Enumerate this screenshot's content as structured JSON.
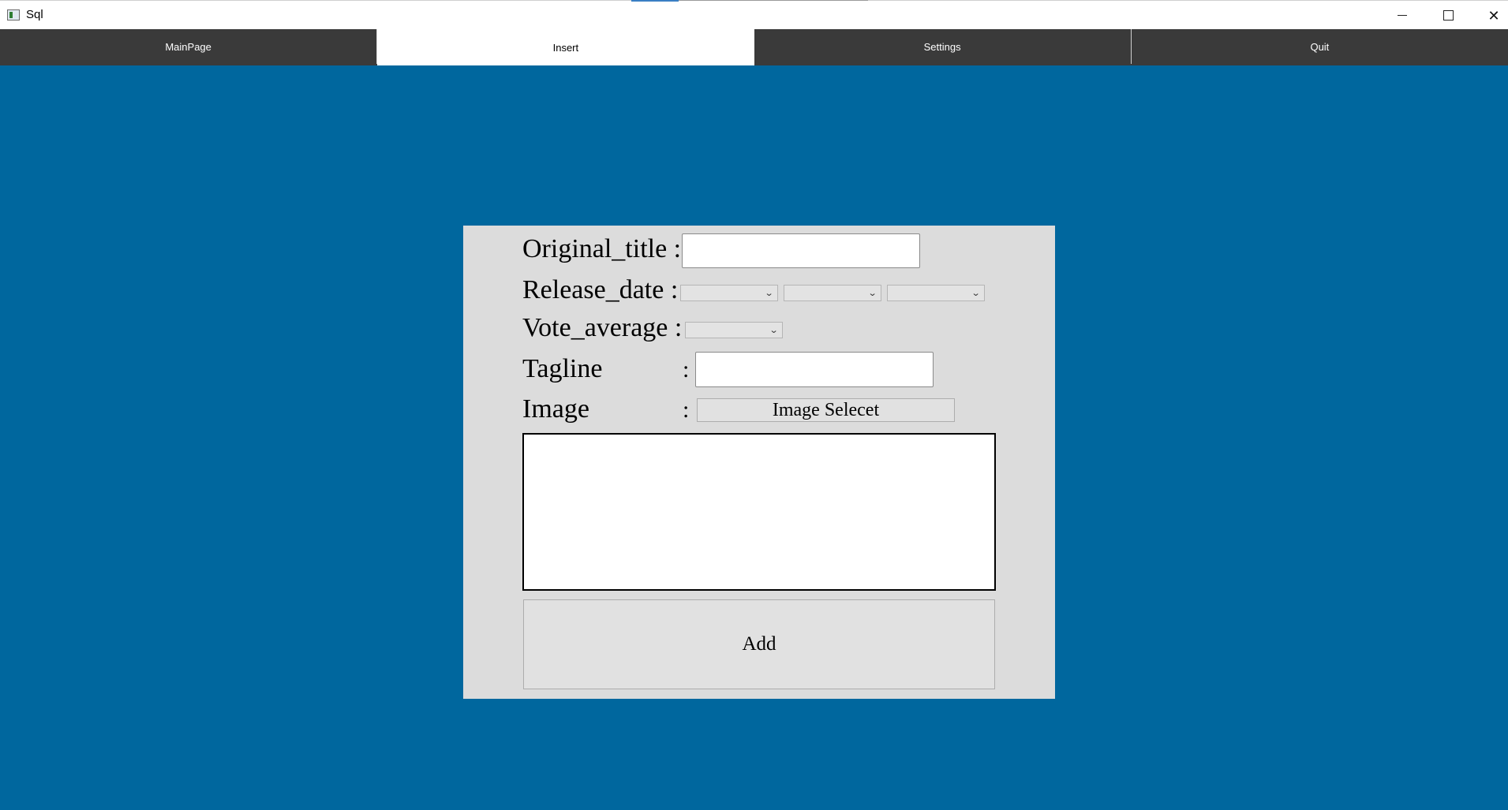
{
  "window": {
    "title": "Sql",
    "controls": {
      "minimize": "minimize-icon",
      "maximize": "maximize-icon",
      "close": "close-icon"
    }
  },
  "tabs": [
    {
      "label": "MainPage",
      "active": false
    },
    {
      "label": "Insert",
      "active": true
    },
    {
      "label": "Settings",
      "active": false
    },
    {
      "label": "Quit",
      "active": false
    }
  ],
  "form": {
    "original_title_label": "Original_title :",
    "original_title_value": "",
    "release_date_label": "Release_date :",
    "release_date_day": "",
    "release_date_month": "",
    "release_date_year": "",
    "vote_average_label": "Vote_average :",
    "vote_average_value": "",
    "tagline_label": "Tagline",
    "tagline_colon": ":",
    "tagline_value": "",
    "image_label": "Image",
    "image_colon": ":",
    "image_button_label": "Image Selecet",
    "add_button_label": "Add"
  },
  "colors": {
    "background": "#00679e",
    "tabbar": "#3a3a3a",
    "panel": "#dcdcdc"
  }
}
